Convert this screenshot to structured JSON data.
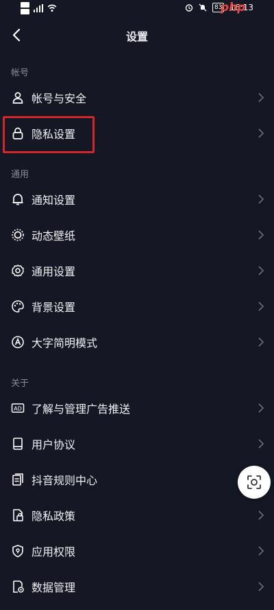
{
  "status_bar": {
    "battery": "83",
    "time": "16:13"
  },
  "watermark": "php",
  "header": {
    "title": "设置"
  },
  "sections": {
    "account": "帐号",
    "general": "通用",
    "about": "关于"
  },
  "items": [
    {
      "label": "帐号与安全",
      "icon": "person-icon"
    },
    {
      "label": "隐私设置",
      "icon": "lock-icon",
      "highlighted": true
    },
    {
      "label": "通知设置",
      "icon": "bell-icon"
    },
    {
      "label": "动态壁纸",
      "icon": "wallpaper-icon"
    },
    {
      "label": "通用设置",
      "icon": "gear-icon"
    },
    {
      "label": "背景设置",
      "icon": "palette-icon"
    },
    {
      "label": "大字简明模式",
      "icon": "large-font-icon"
    },
    {
      "label": "了解与管理广告推送",
      "icon": "ad-icon"
    },
    {
      "label": "用户协议",
      "icon": "book-icon"
    },
    {
      "label": "抖音规则中心",
      "icon": "rules-document-icon"
    },
    {
      "label": "隐私政策",
      "icon": "privacy-policy-icon"
    },
    {
      "label": "应用权限",
      "icon": "shield-icon"
    },
    {
      "label": "数据管理",
      "icon": "data-settings-icon"
    }
  ],
  "colors": {
    "background": "#161724",
    "section_label": "#8A8B96",
    "highlight": "#D32627"
  }
}
